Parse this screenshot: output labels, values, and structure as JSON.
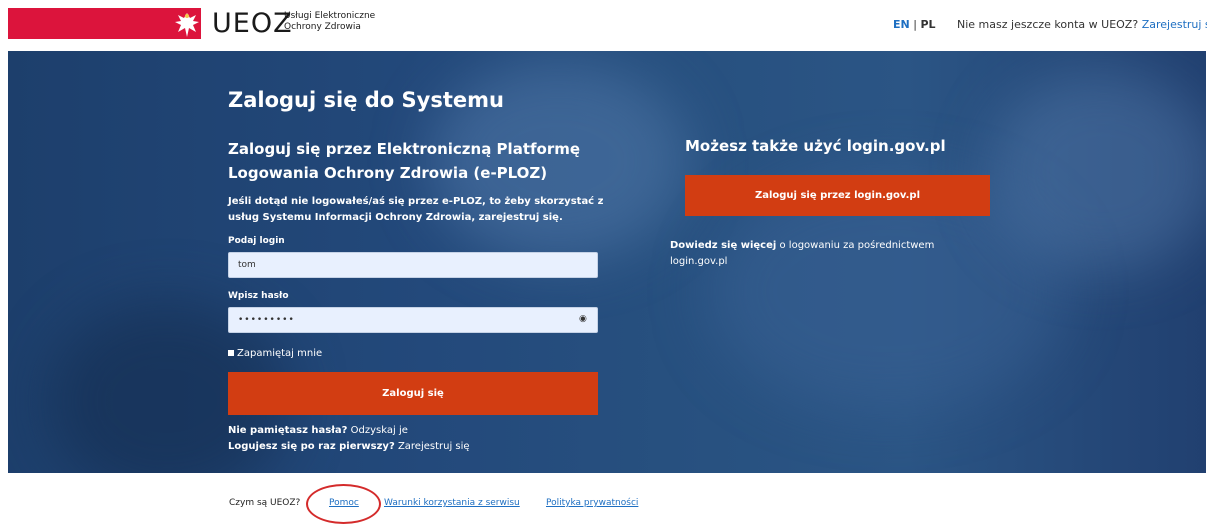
{
  "header": {
    "logo_text": "UEOZ",
    "logo_subtitle": "Usługi Elektroniczne Ochrony Zdrowia",
    "lang_en": "EN",
    "lang_sep": " | ",
    "lang_pl": "PL",
    "no_account_text": "Nie masz jeszcze konta w UEOZ?",
    "register_link": "Zarejestruj się",
    "brand_color": "#dc143c"
  },
  "hero": {
    "title": "Zaloguj się do Systemu",
    "eploz_heading": "Zaloguj się przez Elektroniczną Platformę Logowania Ochrony Zdrowia (e-PLOZ)",
    "info_text": "Jeśli dotąd nie logowałeś/aś się przez e-PLOZ, to żeby skorzystać z usług Systemu Informacji Ochrony Zdrowia, zarejestruj się.",
    "login_label": "Podaj login",
    "login_value": "tom",
    "password_label": "Wpisz hasło",
    "password_value": "•••••••••",
    "eye_icon": "eye-icon",
    "remember_label": "Zapamiętaj mnie",
    "login_button": "Zaloguj się",
    "forgot_bold": "Nie pamiętasz hasła?",
    "forgot_link": "Odzyskaj je",
    "first_time_bold": "Logujesz się po raz pierwszy?",
    "first_time_link": "Zarejestruj się",
    "alt_heading": "Możesz także użyć login.gov.pl",
    "gov_button": "Zaloguj się przez login.gov.pl",
    "gov_info_bold": "Dowiedz się więcej",
    "gov_info_rest": "o logowaniu za pośrednictwem login.gov.pl",
    "accent_color": "#d23d12"
  },
  "footer": {
    "what_is": "Czym są UEOZ?",
    "help": "Pomoc",
    "terms": "Warunki korzystania z serwisu",
    "privacy": "Polityka prywatności"
  }
}
